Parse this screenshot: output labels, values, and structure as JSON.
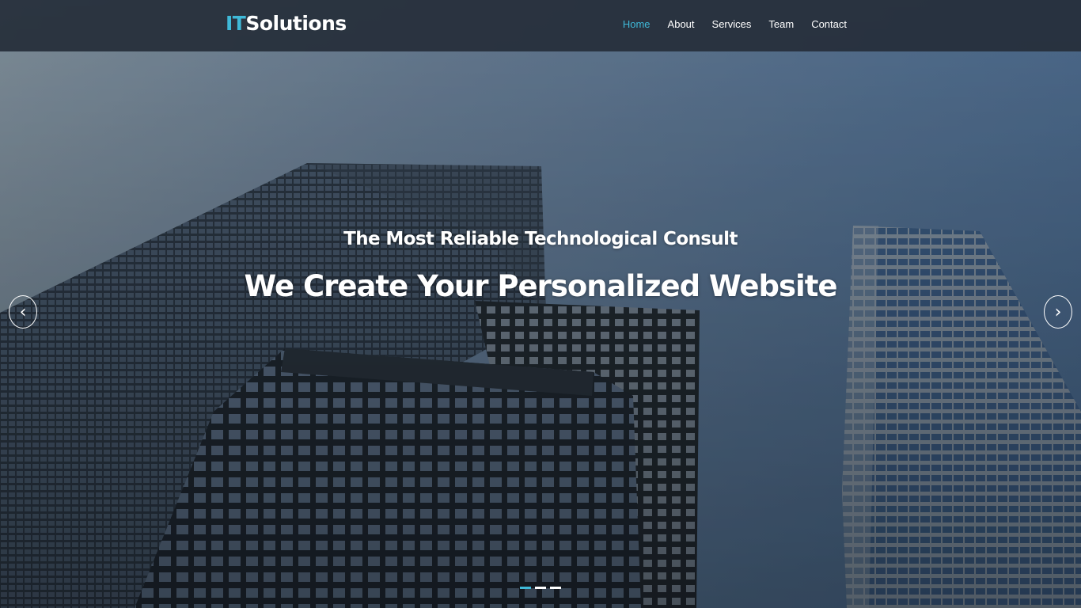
{
  "brand": {
    "prefix": "IT",
    "suffix": "Solutions"
  },
  "nav": {
    "items": [
      {
        "label": "Home",
        "active": true
      },
      {
        "label": "About",
        "active": false
      },
      {
        "label": "Services",
        "active": false
      },
      {
        "label": "Team",
        "active": false
      },
      {
        "label": "Contact",
        "active": false
      }
    ]
  },
  "hero": {
    "subtitle": "The Most Reliable Technological Consult",
    "title": "We Create Your Personalized Website",
    "prev_icon": "chevron-left-icon",
    "next_icon": "chevron-right-icon",
    "prev_glyph": "‹",
    "next_glyph": "›",
    "slides": 3,
    "active_slide": 1
  },
  "colors": {
    "accent": "#3fb9d8",
    "navbar": "#262e3a",
    "text": "#ffffff"
  }
}
